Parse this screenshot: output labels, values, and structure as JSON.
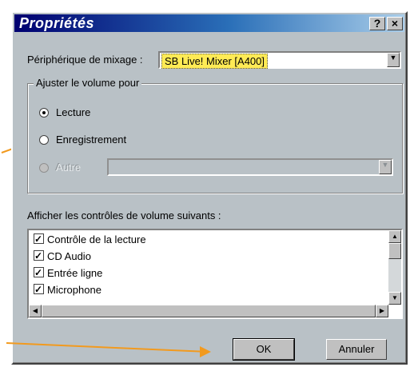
{
  "dialog": {
    "title": "Propriétés",
    "help_btn": "?",
    "close_btn": "×"
  },
  "mixer": {
    "label": "Périphérique de mixage :",
    "value": "SB Live! Mixer [A400]"
  },
  "volume_group": {
    "legend": "Ajuster le volume pour",
    "options": [
      {
        "label": "Lecture",
        "selected": true
      },
      {
        "label": "Enregistrement",
        "selected": false
      },
      {
        "label": "Autre",
        "selected": false,
        "disabled": true
      }
    ]
  },
  "controls": {
    "label": "Afficher les contrôles de volume suivants :",
    "items": [
      {
        "label": "Contrôle de la lecture",
        "checked": true
      },
      {
        "label": "CD Audio",
        "checked": true
      },
      {
        "label": "Entrée ligne",
        "checked": true
      },
      {
        "label": "Microphone",
        "checked": true
      }
    ]
  },
  "buttons": {
    "ok": "OK",
    "cancel": "Annuler"
  },
  "colors": {
    "annotation_arrow": "#f29a1e",
    "selected_highlight": "#ffeb55"
  }
}
